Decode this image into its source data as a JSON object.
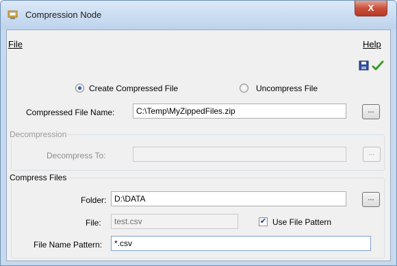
{
  "window": {
    "title": "Compression Node",
    "close_label": "X"
  },
  "menu": {
    "file": "File",
    "help": "Help"
  },
  "toolbar": {
    "save_icon": "save-icon",
    "ok_icon": "checkmark-icon"
  },
  "mode": {
    "options": [
      {
        "label": "Create Compressed File",
        "selected": true
      },
      {
        "label": "Uncompress File",
        "selected": false
      }
    ]
  },
  "compressed_file": {
    "label": "Compressed File Name:",
    "value": "C:\\Temp\\MyZippedFiles.zip",
    "browse_label": "..."
  },
  "decompression": {
    "group_title": "Decompression",
    "label": "Decompress To:",
    "value": "",
    "browse_label": "..."
  },
  "compress_files": {
    "group_title": "Compress Files",
    "folder_label": "Folder:",
    "folder_value": "D:\\DATA",
    "browse_label": "...",
    "file_label": "File:",
    "file_value": "test.csv",
    "use_pattern_label": "Use File Pattern",
    "use_pattern_checked": true,
    "pattern_label": "File Name Pattern:",
    "pattern_value": "*.csv"
  },
  "colors": {
    "accent": "#2b5aa8",
    "check": "#1e3d8f",
    "ok_green": "#3a9a2a"
  }
}
